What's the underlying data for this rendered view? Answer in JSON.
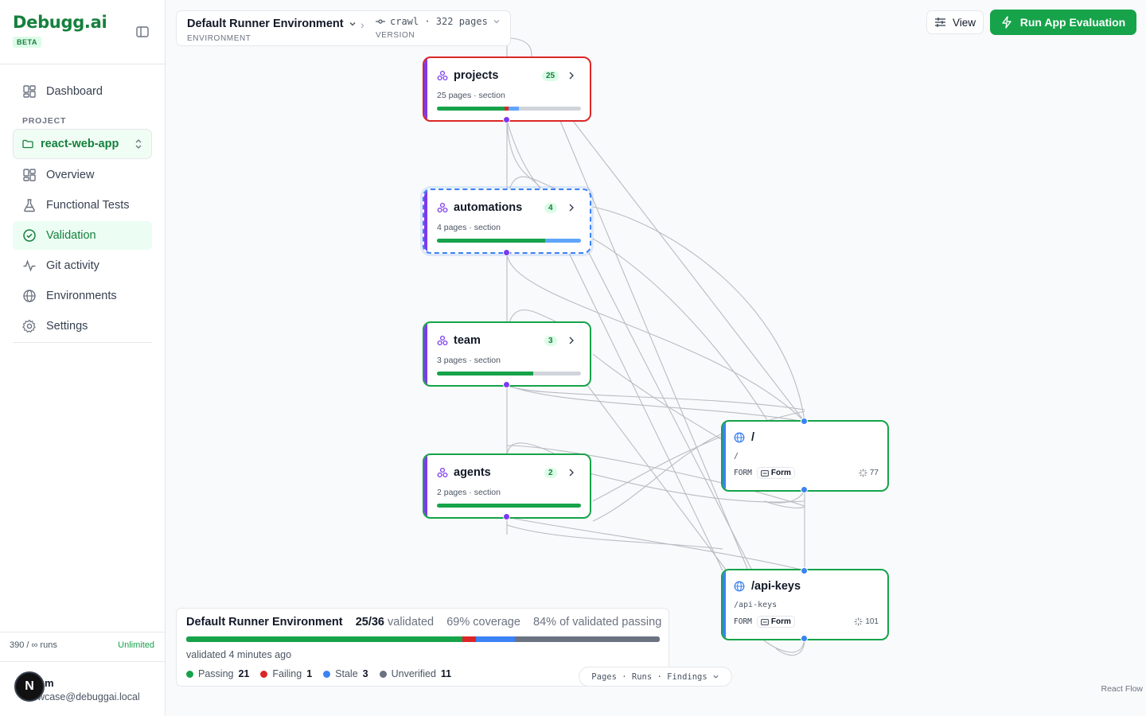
{
  "brand": {
    "logo": "Debugg.ai",
    "badge": "BETA"
  },
  "sidebar": {
    "dashboard": "Dashboard",
    "section_label": "PROJECT",
    "project": "react-web-app",
    "items": [
      {
        "label": "Overview",
        "icon": "grid-icon"
      },
      {
        "label": "Functional Tests",
        "icon": "flask-icon"
      },
      {
        "label": "Validation",
        "icon": "check-circle-icon",
        "active": true
      },
      {
        "label": "Git activity",
        "icon": "activity-icon"
      },
      {
        "label": "Environments",
        "icon": "globe-icon"
      },
      {
        "label": "Settings",
        "icon": "gear-icon"
      }
    ],
    "runs": "390 / ∞ runs",
    "plan": "Unlimited",
    "user": {
      "avatar": "N",
      "name": "m",
      "email": "owcase@debuggai.local"
    }
  },
  "toolbar": {
    "environment": "Default Runner Environment",
    "environment_label": "ENVIRONMENT",
    "version": "crawl · 322 pages",
    "version_label": "VERSION",
    "view_label": "View",
    "run_label": "Run App Evaluation"
  },
  "colors": {
    "accent": "#16a34a",
    "section": "#7c3aed",
    "page": "#3b82f6",
    "failing": "#dc2626",
    "stale": "#3b82f6",
    "unverified": "#6b7280"
  },
  "section_nodes": [
    {
      "name": "projects",
      "count": "25",
      "subtitle": "25 pages · section",
      "status": "failing",
      "progress": {
        "pass": 0.47,
        "fail": 0.03,
        "stale": 0.07
      }
    },
    {
      "name": "automations",
      "count": "4",
      "subtitle": "4 pages · section",
      "status": "selected",
      "progress": {
        "pass": 0.75,
        "fail": 0,
        "stale": 0.25
      }
    },
    {
      "name": "team",
      "count": "3",
      "subtitle": "3 pages · section",
      "status": "passing",
      "progress": {
        "pass": 0.67,
        "fail": 0,
        "stale": 0
      }
    },
    {
      "name": "agents",
      "count": "2",
      "subtitle": "2 pages · section",
      "status": "passing",
      "progress": {
        "pass": 1.0,
        "fail": 0,
        "stale": 0
      }
    }
  ],
  "page_nodes": [
    {
      "title": "/",
      "path": "/",
      "type": "FORM",
      "chip": "Form",
      "score": "77"
    },
    {
      "title": "/api-keys",
      "path": "/api-keys",
      "type": "FORM",
      "chip": "Form",
      "score": "101"
    }
  ],
  "summary": {
    "environment": "Default Runner Environment",
    "validated_count": "25/36",
    "validated_word": "validated",
    "coverage": "69% coverage",
    "passing_rate": "84% of validated passing",
    "updated": "validated 4 minutes ago",
    "legend": [
      {
        "label": "Passing",
        "count": "21",
        "color": "#16a34a"
      },
      {
        "label": "Failing",
        "count": "1",
        "color": "#dc2626"
      },
      {
        "label": "Stale",
        "count": "3",
        "color": "#3b82f6"
      },
      {
        "label": "Unverified",
        "count": "11",
        "color": "#6b7280"
      }
    ],
    "totals": {
      "passing": 21,
      "failing": 1,
      "stale": 3,
      "unverified": 11
    }
  },
  "view_tabs": "Pages · Runs · Findings",
  "attribution": "React Flow"
}
